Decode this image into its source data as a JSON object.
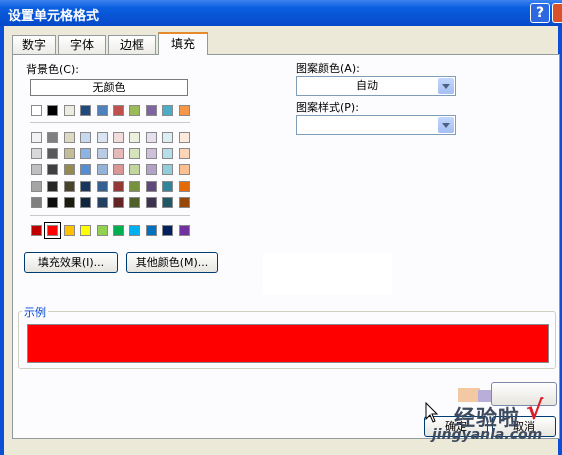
{
  "window": {
    "title": "设置单元格格式",
    "help_label": "?",
    "close_label": "×"
  },
  "tabs": [
    "数字",
    "字体",
    "边框",
    "填充"
  ],
  "background": {
    "label": "背景色(C):",
    "no_color_label": "无颜色",
    "theme_top_row": [
      "#ffffff",
      "#000000",
      "#eeece1",
      "#1f497d",
      "#4f81bd",
      "#c0504d",
      "#9bbb59",
      "#8064a2",
      "#4bacc6",
      "#f79646"
    ],
    "theme_shades": [
      [
        "#f2f2f2",
        "#7f7f7f",
        "#ddd9c3",
        "#c6d9f0",
        "#dbe5f1",
        "#f2dcdb",
        "#ebf1dd",
        "#e5e0ec",
        "#dbeef3",
        "#fdeada"
      ],
      [
        "#d8d8d8",
        "#595959",
        "#c4bd97",
        "#8db3e2",
        "#b8cce4",
        "#e5b9b7",
        "#d7e3bc",
        "#ccc1d9",
        "#b7dde8",
        "#fbd5b5"
      ],
      [
        "#bfbfbf",
        "#3f3f3f",
        "#938953",
        "#548dd4",
        "#95b3d7",
        "#d99694",
        "#c3d69b",
        "#b2a2c7",
        "#92cddc",
        "#fac08f"
      ],
      [
        "#a5a5a5",
        "#262626",
        "#494429",
        "#17365d",
        "#366092",
        "#953734",
        "#76923c",
        "#5f497a",
        "#31859b",
        "#e36c09"
      ],
      [
        "#7f7f7f",
        "#0c0c0c",
        "#1d1b10",
        "#0f243e",
        "#244061",
        "#632423",
        "#4f6128",
        "#3f3151",
        "#205867",
        "#974806"
      ]
    ],
    "standard": [
      "#c00000",
      "#ff0000",
      "#ffc000",
      "#ffff00",
      "#92d050",
      "#00b050",
      "#00b0f0",
      "#0070c0",
      "#002060",
      "#7030a0"
    ],
    "selected_standard_index": 1,
    "fill_effects_button": "填充效果(I)...",
    "more_colors_button": "其他颜色(M)..."
  },
  "pattern": {
    "color_label": "图案颜色(A):",
    "color_value": "自动",
    "style_label": "图案样式(P):",
    "style_value": ""
  },
  "sample": {
    "label": "示例",
    "color": "#ff0000"
  },
  "footer": {
    "ok_label": "确定",
    "cancel_label": "取消"
  },
  "watermark": {
    "text_cn": "经验啦",
    "check": "√",
    "url": "jingyanla.com"
  }
}
